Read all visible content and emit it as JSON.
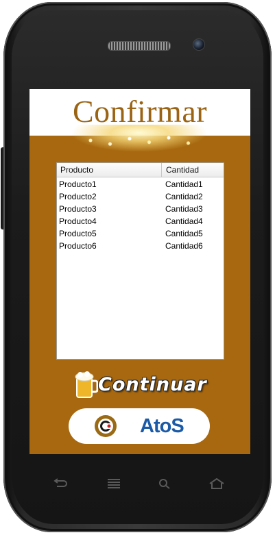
{
  "screen": {
    "title": "Confirmar",
    "table": {
      "columns": [
        "Producto",
        "Cantidad"
      ],
      "rows": [
        [
          "Producto1",
          "Cantidad1"
        ],
        [
          "Producto2",
          "Cantidad2"
        ],
        [
          "Producto3",
          "Cantidad3"
        ],
        [
          "Producto4",
          "Cantidad4"
        ],
        [
          "Producto5",
          "Cantidad5"
        ],
        [
          "Producto6",
          "Cantidad6"
        ]
      ]
    },
    "continue_button": {
      "label": "Continuar",
      "icon": "beer-mug-icon"
    },
    "footer_logos": {
      "left_logo": "c-circle-logo",
      "right_logo_text": "AtoS"
    }
  },
  "device": {
    "nav_icons": [
      "back-icon",
      "menu-icon",
      "search-icon",
      "home-icon"
    ]
  },
  "colors": {
    "screen_background": "#a7680f",
    "title": "#9a6414",
    "atos_blue": "#1b5aa6"
  }
}
